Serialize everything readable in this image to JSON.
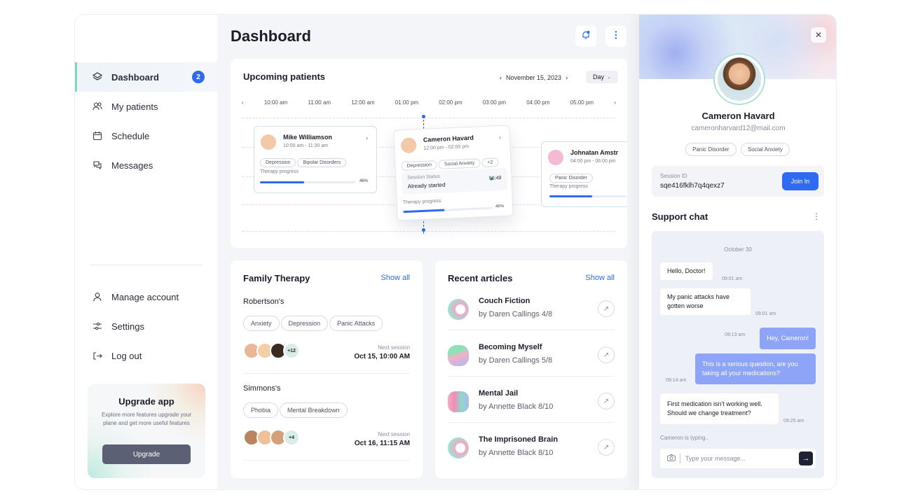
{
  "sidebar": {
    "nav": [
      {
        "label": "Dashboard",
        "icon": "layers-icon",
        "badge": "2",
        "active": true
      },
      {
        "label": "My patients",
        "icon": "users-icon"
      },
      {
        "label": "Schedule",
        "icon": "calendar-icon"
      },
      {
        "label": "Messages",
        "icon": "chat-icon"
      }
    ],
    "bottom": [
      {
        "label": "Manage account",
        "icon": "user-icon"
      },
      {
        "label": "Settings",
        "icon": "settings-icon"
      },
      {
        "label": "Log out",
        "icon": "logout-icon"
      }
    ],
    "upgrade": {
      "title": "Upgrade app",
      "text": "Explore more features upgrade your plane and get more useful features",
      "button": "Upgrade"
    }
  },
  "header": {
    "title": "Dashboard"
  },
  "upcoming": {
    "title": "Upcoming patients",
    "date": "November 15, 2023",
    "view": "Day",
    "times": [
      "10:00 am",
      "11:00 am",
      "12:00 am",
      "01:00 pm",
      "02:00 pm",
      "03:00 pm",
      "04:00 pm",
      "05:00 pm"
    ],
    "patients": [
      {
        "name": "Mike Williamson",
        "time": "10:00 am - 11:30 am",
        "tags": [
          "Depression",
          "Bipolar Disorders"
        ],
        "progress_label": "Therapy progress",
        "progress": "46%"
      },
      {
        "name": "Cameron Havard",
        "time": "12:00 pm - 02:00 pm",
        "tags": [
          "Depression",
          "Social Anxiety",
          "+2"
        ],
        "status_label": "Session Status",
        "status": "Already started",
        "timer": "56:49",
        "progress_label": "Therapy progress",
        "progress": "46%"
      },
      {
        "name": "Johnatan Amstr",
        "time": "04:00 pm - 06:00 pm",
        "tags": [
          "Panic Disorder"
        ],
        "progress_label": "Therapy progress"
      }
    ]
  },
  "family": {
    "title": "Family Therapy",
    "show_all": "Show all",
    "groups": [
      {
        "name": "Robertson's",
        "tags": [
          "Anxiety",
          "Depression",
          "Panic Attacks"
        ],
        "more": "+12",
        "next_label": "Next session",
        "next": "Oct 15, 10:00 AM"
      },
      {
        "name": "Simmons's",
        "tags": [
          "Phobia",
          "Mental Breakdown"
        ],
        "more": "+4",
        "next_label": "Next session",
        "next": "Oct 16, 11:15 AM"
      }
    ]
  },
  "articles": {
    "title": "Recent articles",
    "show_all": "Show all",
    "items": [
      {
        "title": "Couch Fiction",
        "sub": "by Daren Callings 4/8"
      },
      {
        "title": "Becoming Myself",
        "sub": "by Daren Callings 5/8"
      },
      {
        "title": "Mental Jail",
        "sub": "by Annette Black 8/10"
      },
      {
        "title": "The Imprisoned Brain",
        "sub": "by Annette Black 8/10"
      }
    ]
  },
  "profile": {
    "name": "Cameron Havard",
    "email": "cameronharvard12@mail.com",
    "tags": [
      "Panic Disorder",
      "Social Anxiety"
    ],
    "session_label": "Session ID",
    "session_id": "sqe416fklh7q4qexz7",
    "join": "Join In"
  },
  "chat": {
    "title": "Support chat",
    "date": "October 30",
    "messages": [
      {
        "text": "Hello, Doctor!",
        "time": "09:01 am",
        "dir": "in"
      },
      {
        "text": "My panic attacks have gotten worse",
        "time": "09:01 am",
        "dir": "in"
      },
      {
        "text": "Hey, Cameron!",
        "time": "09:13 am",
        "dir": "out"
      },
      {
        "text": "This is a serious question, are you taking all your medications?",
        "time": "09:14 am",
        "dir": "out"
      },
      {
        "text": "First medication isn't working well. Should we change treatment?",
        "time": "09:25 am",
        "dir": "in"
      }
    ],
    "typing": "Cameron is typing..",
    "placeholder": "Type your message..."
  },
  "colors": {
    "accent": "#2f6bf2",
    "bubble_out": "#8ea4f6",
    "active_border": "#7fd6c2"
  }
}
